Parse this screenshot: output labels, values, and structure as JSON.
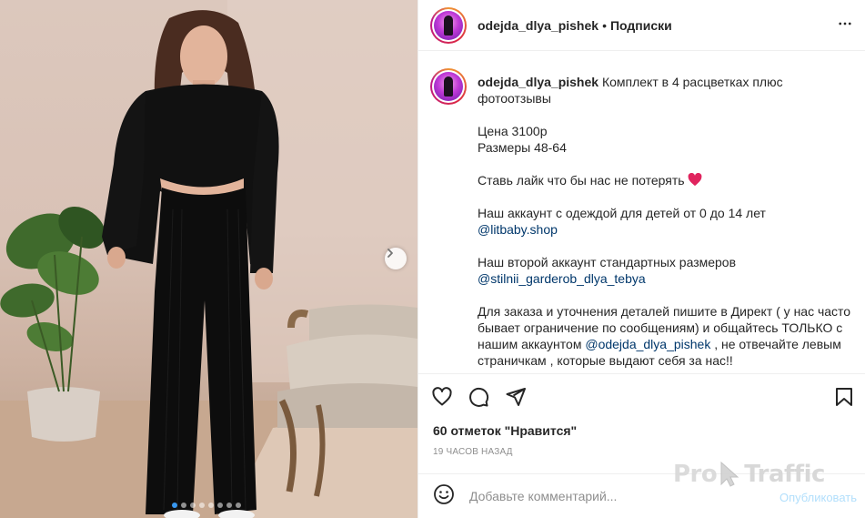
{
  "post": {
    "username": "odejda_dlya_pishek",
    "separator": "•",
    "follow_label": "Подписки",
    "slide_count": 8,
    "active_slide": 1
  },
  "caption": {
    "username": "odejda_dlya_pishek",
    "intro": "Комплект в 4 расцветках плюс фотоотзывы",
    "price": "Цена 3100р",
    "sizes": "Размеры 48-64",
    "like_prompt": "Ставь лайк что бы нас не потерять",
    "kids_account": "Наш аккаунт с одеждой для детей от 0 до 14 лет",
    "kids_mention": "@litbaby.shop",
    "second_account": "Наш второй аккаунт стандартных размеров",
    "second_mention": "@stilnii_garderob_dlya_tebya",
    "order_text_1": "Для заказа и уточнения деталей пишите в Директ ( у нас часто",
    "order_text_2": "бывает ограничение по сообщениям) и общайтесь ТОЛЬКО с",
    "order_text_3_pre": "нашим аккаунтом",
    "order_mention": "@odejda_dlya_pishek",
    "order_text_3_post": ", не отвечайте левым",
    "order_text_4": "страничкам , которые выдают себя за нас!!"
  },
  "stats": {
    "likes": "60 отметок \"Нравится\"",
    "time": "19 часов назад"
  },
  "comment": {
    "placeholder": "Добавьте комментарий...",
    "publish_label": "Опубликовать"
  },
  "watermark": {
    "pro": "Pro",
    "traffic": "Traffic"
  },
  "icons": {
    "like": "heart-outline-icon",
    "comment": "speech-bubble-icon",
    "share": "paper-plane-icon",
    "save": "bookmark-icon",
    "more": "ellipsis-icon",
    "emoji": "smiley-icon",
    "next": "chevron-right-icon"
  },
  "colors": {
    "mention": "#00376b",
    "publish": "#b2dffc",
    "active_dot": "#3897f0",
    "heart_emoji": "#e0245e"
  }
}
